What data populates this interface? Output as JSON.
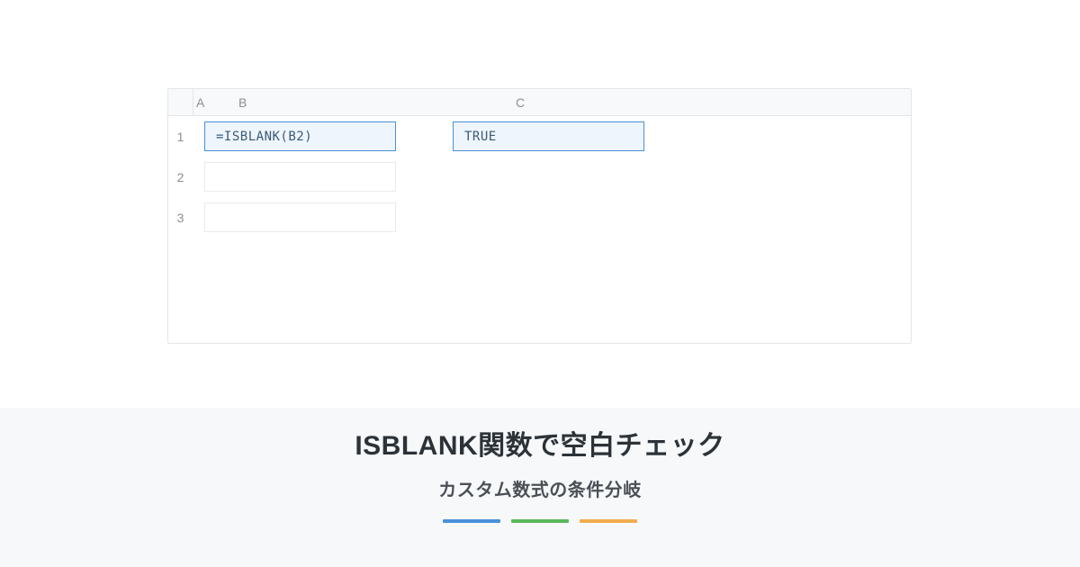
{
  "spreadsheet": {
    "columns": {
      "a": "A",
      "b": "B",
      "c": "C"
    },
    "rows": {
      "r1": "1",
      "r2": "2",
      "r3": "3"
    },
    "cells": {
      "formula": "=ISBLANK(B2)",
      "result": "TRUE"
    }
  },
  "titles": {
    "main": "ISBLANK関数で空白チェック",
    "sub": "カスタム数式の条件分岐"
  },
  "colors": {
    "accent_blue": "#4a90d9",
    "accent_green": "#5cb85c",
    "accent_orange": "#f0ad4e"
  }
}
